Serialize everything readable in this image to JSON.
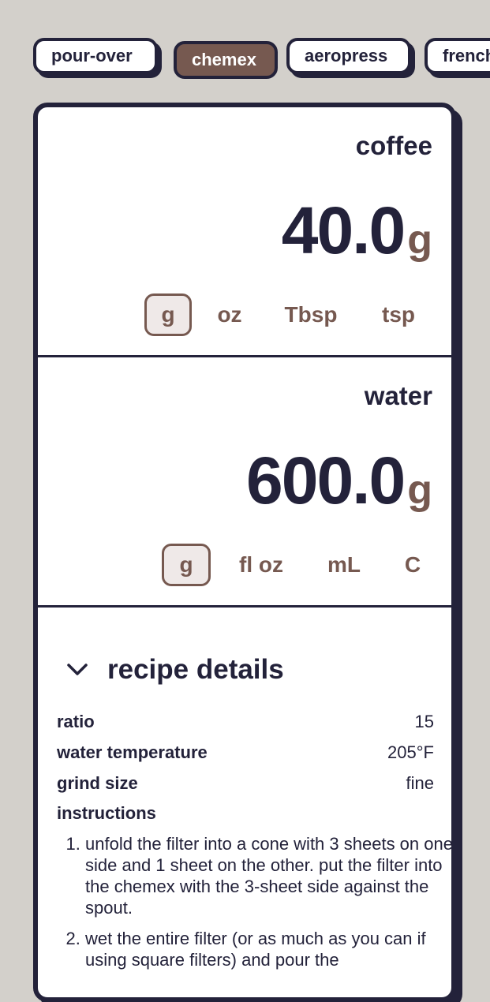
{
  "tabs": [
    {
      "label": "pour-over",
      "active": false
    },
    {
      "label": "chemex",
      "active": true
    },
    {
      "label": "aeropress",
      "active": false
    },
    {
      "label": "french",
      "active": false
    }
  ],
  "coffee": {
    "title": "coffee",
    "value": "40.0",
    "unit": "g",
    "unit_options": [
      "g",
      "oz",
      "Tbsp",
      "tsp"
    ],
    "selected_unit": "g"
  },
  "water": {
    "title": "water",
    "value": "600.0",
    "unit": "g",
    "unit_options": [
      "g",
      "fl oz",
      "mL",
      "C"
    ],
    "selected_unit": "g"
  },
  "details": {
    "title": "recipe details",
    "chevron_icon": "chevron-down-icon",
    "rows": [
      {
        "key": "ratio",
        "value": "15"
      },
      {
        "key": "water temperature",
        "value": "205°F"
      },
      {
        "key": "grind size",
        "value": "fine"
      }
    ],
    "instructions_label": "instructions",
    "steps": [
      "unfold the filter into a cone with 3 sheets on one side and 1 sheet on the other. put the filter into the chemex with the 3-sheet side against the spout.",
      "wet the entire filter (or as much as you can if using square filters) and pour the"
    ]
  },
  "colors": {
    "background": "#d3d0cb",
    "ink": "#23223a",
    "accent": "#765950",
    "selected_fill": "#efe9e8"
  }
}
